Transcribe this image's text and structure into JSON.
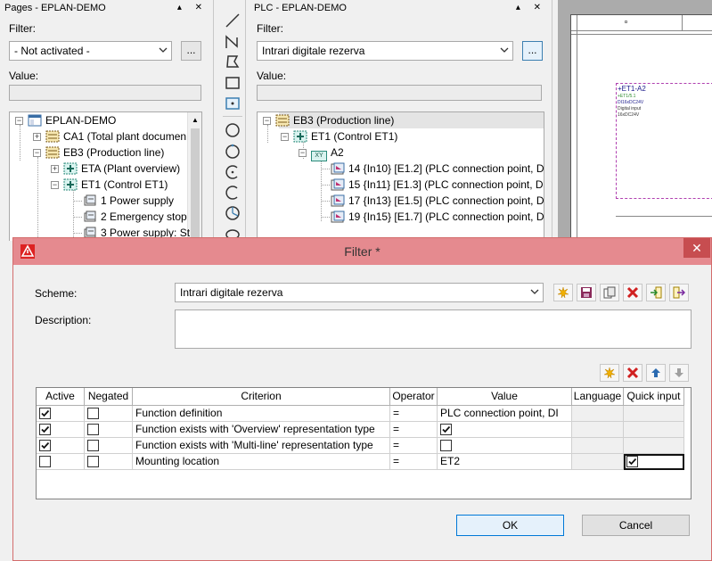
{
  "pages_panel": {
    "title": "Pages - EPLAN-DEMO",
    "filter_label": "Filter:",
    "filter_value": "- Not activated -",
    "dots": "...",
    "value_label": "Value:",
    "tree": [
      {
        "label": "EPLAN-DEMO"
      },
      {
        "label": "CA1 (Total plant documen"
      },
      {
        "label": "EB3 (Production line)"
      },
      {
        "label": "ETA (Plant overview)"
      },
      {
        "label": "ET1 (Control ET1)"
      },
      {
        "label": "1 Power supply"
      },
      {
        "label": "2 Emergency stop"
      },
      {
        "label": "3 Power supply: St"
      }
    ]
  },
  "plc_panel": {
    "title": "PLC - EPLAN-DEMO",
    "filter_label": "Filter:",
    "filter_value": "Intrari digitale rezerva",
    "dots": "...",
    "value_label": "Value:",
    "tree": [
      {
        "label": "EB3 (Production line)"
      },
      {
        "label": "ET1 (Control ET1)"
      },
      {
        "label": "A2"
      },
      {
        "label": "14 {In10} [E1.2] (PLC connection point, DI"
      },
      {
        "label": "15 {In11} [E1.3] (PLC connection point, DI"
      },
      {
        "label": "17 {In13} [E1.5] (PLC connection point, DI"
      },
      {
        "label": "19 {In15} [E1.7] (PLC connection point, DI"
      }
    ],
    "xy_badge": "XY"
  },
  "drawing": {
    "tag": "+ET1-A2",
    "line1": "+ET1/5.1",
    "line2": "DI16xDC24V",
    "line3": "Digital input",
    "line4": "16xDC24V"
  },
  "dialog": {
    "title": "Filter *",
    "close": "✕",
    "scheme_label": "Scheme:",
    "scheme_value": "Intrari digitale rezerva",
    "description_label": "Description:",
    "columns": [
      "Active",
      "Negated",
      "Criterion",
      "Operator",
      "Value",
      "Language",
      "Quick input"
    ],
    "rows": [
      {
        "active": true,
        "negated": false,
        "criterion": "Function definition",
        "operator": "=",
        "value_text": "PLC connection point, DI",
        "value_check": null,
        "quick": null
      },
      {
        "active": true,
        "negated": false,
        "criterion": "Function exists with 'Overview' representation type",
        "operator": "=",
        "value_text": "",
        "value_check": true,
        "quick": null
      },
      {
        "active": true,
        "negated": false,
        "criterion": "Function exists with 'Multi-line' representation type",
        "operator": "=",
        "value_text": "",
        "value_check": false,
        "quick": null
      },
      {
        "active": false,
        "negated": false,
        "criterion": "Mounting location",
        "operator": "=",
        "value_text": "ET2",
        "value_check": null,
        "quick": true
      }
    ],
    "ok": "OK",
    "cancel": "Cancel"
  },
  "colors": {
    "dialog_title_bg": "#e58a8f",
    "close_bg": "#c74d50",
    "magenta_frame": "#b040b0",
    "accent": "#0078d7"
  }
}
